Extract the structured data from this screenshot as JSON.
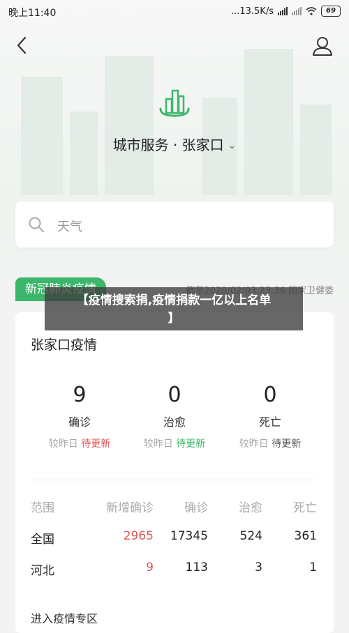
{
  "status_bar": {
    "time": "晚上11:40",
    "network_speed": "...13.5K/s",
    "battery": "69"
  },
  "header": {
    "city_title": "城市服务 · 张家口"
  },
  "search": {
    "placeholder": "天气"
  },
  "section": {
    "tag": "新冠肺炎疫情",
    "source": "截至2020/02/03 23:36 国家卫健委"
  },
  "card": {
    "title": "张家口疫情",
    "stats": [
      {
        "value": "9",
        "label": "确诊",
        "compare": "较昨日",
        "update": "待更新"
      },
      {
        "value": "0",
        "label": "治愈",
        "compare": "较昨日",
        "update": "待更新"
      },
      {
        "value": "0",
        "label": "死亡",
        "compare": "较昨日",
        "update": "待更新"
      }
    ],
    "table": {
      "headers": [
        "范围",
        "新增确诊",
        "确诊",
        "治愈",
        "死亡"
      ],
      "rows": [
        [
          "全国",
          "2965",
          "17345",
          "524",
          "361"
        ],
        [
          "河北",
          "9",
          "113",
          "3",
          "1"
        ]
      ]
    },
    "more_link": "进入疫情专区"
  },
  "overlay": {
    "line1": "【疫情搜索捐,疫情捐款一亿以上名单",
    "line2": "】"
  },
  "colors": {
    "accent_green": "#3cb66b",
    "alert_red": "#e05656"
  }
}
